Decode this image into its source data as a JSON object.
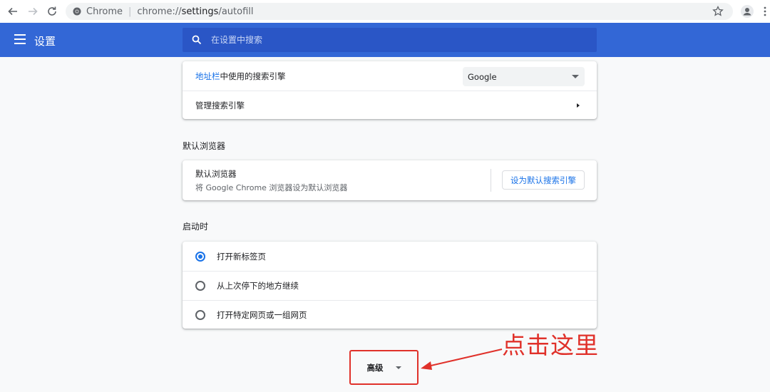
{
  "browser": {
    "site_label": "Chrome",
    "url_scheme": "chrome://",
    "url_host": "settings",
    "url_path": "/autofill"
  },
  "header": {
    "title": "设置",
    "search_placeholder": "在设置中搜索"
  },
  "search_engine": {
    "row1_link": "地址栏",
    "row1_text": "中使用的搜索引擎",
    "row1_selected": "Google",
    "row2_label": "管理搜索引擎"
  },
  "default_browser": {
    "section_title": "默认浏览器",
    "primary": "默认浏览器",
    "secondary": "将 Google Chrome 浏览器设为默认浏览器",
    "button_label": "设为默认搜索引擎"
  },
  "startup": {
    "section_title": "启动时",
    "options": [
      {
        "label": "打开新标签页",
        "checked": true
      },
      {
        "label": "从上次停下的地方继续",
        "checked": false
      },
      {
        "label": "打开特定网页或一组网页",
        "checked": false
      }
    ]
  },
  "advanced": {
    "label": "高级"
  },
  "annotation": {
    "text": "点击这里",
    "color": "#e0312a"
  },
  "colors": {
    "header_blue": "#3367d6",
    "link_blue": "#1a73e8"
  }
}
